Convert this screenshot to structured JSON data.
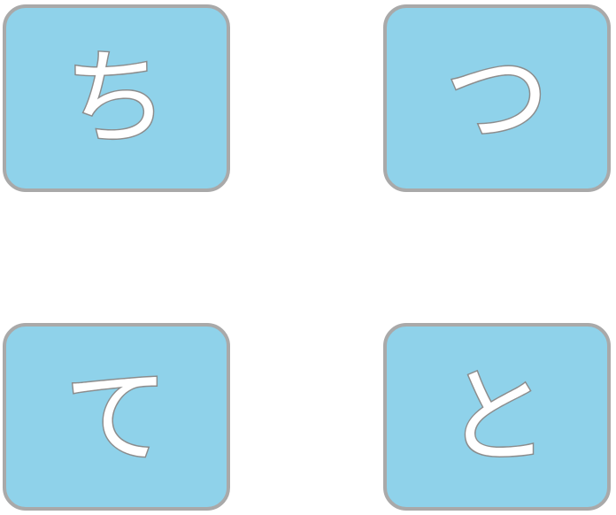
{
  "cards": [
    {
      "char": "ち"
    },
    {
      "char": "つ"
    },
    {
      "char": "て"
    },
    {
      "char": "と"
    }
  ]
}
